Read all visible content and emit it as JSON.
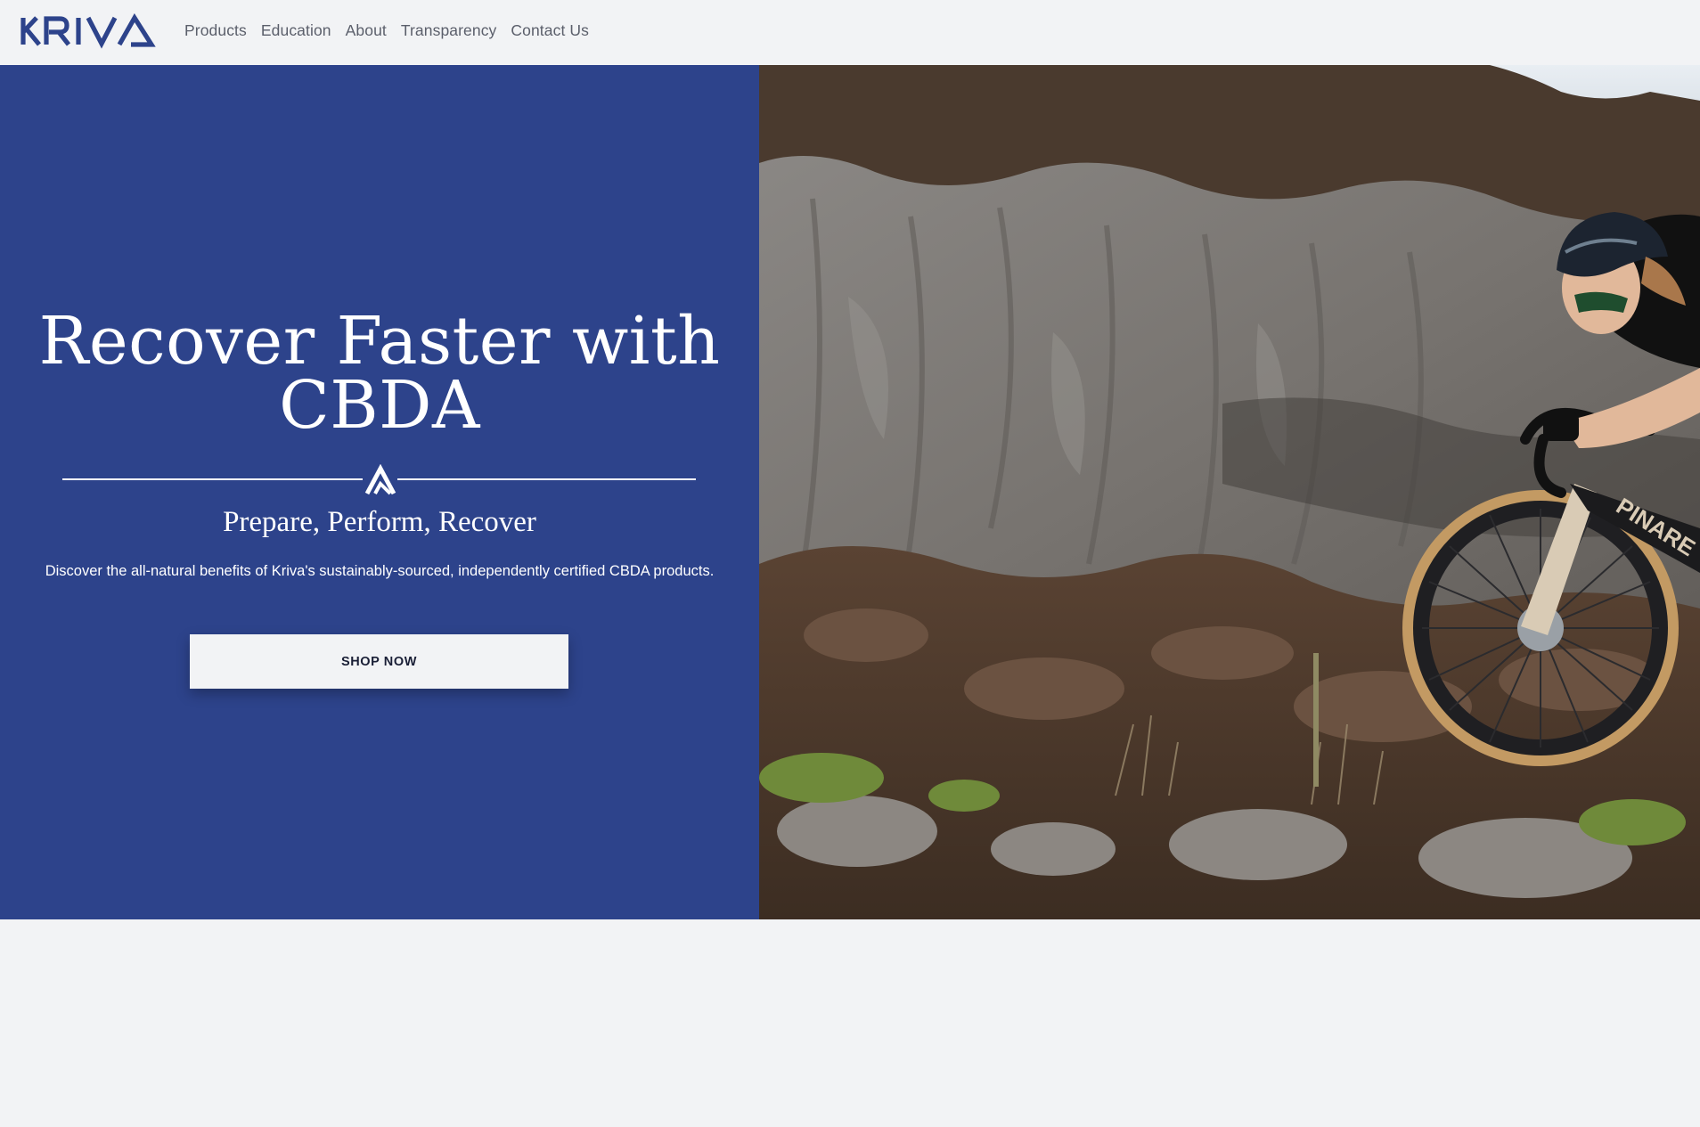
{
  "header": {
    "logo_text": "KRIVA",
    "nav": [
      {
        "label": "Products"
      },
      {
        "label": "Education"
      },
      {
        "label": "About"
      },
      {
        "label": "Transparency"
      },
      {
        "label": "Contact Us"
      }
    ]
  },
  "hero": {
    "title_line1": "Recover Faster with",
    "title_line2": "CBDA",
    "subtitle": "Prepare, Perform, Recover",
    "description": "Discover the all-natural benefits of Kriva's sustainably-sourced, independently certified CBDA products.",
    "cta_label": "SHOP NOW",
    "image_caption": "PINARE"
  },
  "colors": {
    "brand_blue": "#2d438b",
    "page_bg": "#f2f3f5",
    "nav_text": "#5b5f6b",
    "button_text": "#1a1f36"
  }
}
